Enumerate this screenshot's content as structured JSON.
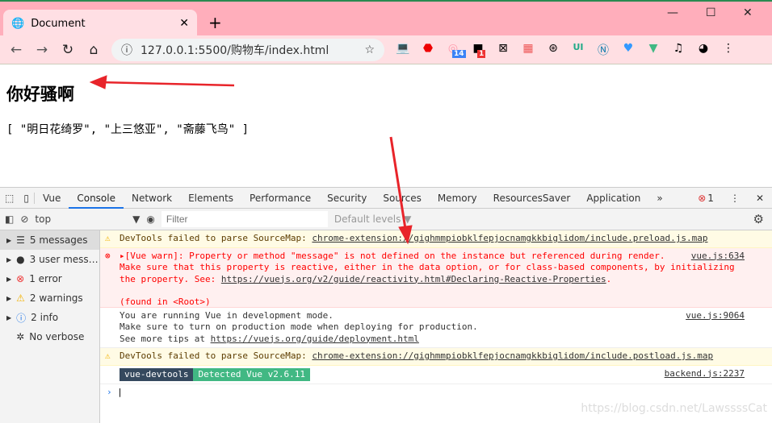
{
  "browser": {
    "tab_title": "Document",
    "url": "127.0.0.1:5500/购物车/index.html",
    "ext_badges": [
      "14",
      "1"
    ]
  },
  "page": {
    "heading": "你好骚啊",
    "array_text": "[ \"明日花绮罗\", \"上三悠亚\", \"斋藤飞鸟\" ]"
  },
  "devtools": {
    "tabs": [
      "Vue",
      "Console",
      "Network",
      "Elements",
      "Performance",
      "Security",
      "Sources",
      "Memory",
      "ResourcesSaver",
      "Application"
    ],
    "error_count": "1",
    "context": "top",
    "filter_placeholder": "Filter",
    "levels": "Default levels ▼",
    "sidebar": [
      {
        "label": "5 messages",
        "icon": "list"
      },
      {
        "label": "3 user mess…",
        "icon": "user"
      },
      {
        "label": "1 error",
        "icon": "error"
      },
      {
        "label": "2 warnings",
        "icon": "warning"
      },
      {
        "label": "2 info",
        "icon": "info"
      },
      {
        "label": "No verbose",
        "icon": "bug"
      }
    ],
    "messages": {
      "w1_text": "DevTools failed to parse SourceMap: ",
      "w1_link": "chrome-extension://gighmmpiobklfepjocnamgkkbiglidom/include.preload.js.map",
      "e_line1": "▸[Vue warn]: Property or method \"message\" is not defined on the instance but referenced during render.",
      "e_line2": "Make sure that this property is reactive, either in the data option, or for class-based components, by initializing",
      "e_line3": "the property. See: ",
      "e_link": "https://vuejs.org/v2/guide/reactivity.html#Declaring-Reactive-Properties",
      "e_dot": ".",
      "e_line4": "(found in <Root>)",
      "e_src": "vue.js:634",
      "i_line1": "You are running Vue in development mode.",
      "i_line2": "Make sure to turn on production mode when deploying for production.",
      "i_line3": "See more tips at ",
      "i_link": "https://vuejs.org/guide/deployment.html",
      "i_src": "vue.js:9064",
      "w2_text": "DevTools failed to parse SourceMap: ",
      "w2_link": "chrome-extension://gighmmpiobklfepjocnamgkkbiglidom/include.postload.js.map",
      "vd_badge1": "vue-devtools",
      "vd_badge2": "Detected Vue v2.6.11",
      "vd_src": "backend.js:2237"
    }
  },
  "watermark": "https://blog.csdn.net/LawssssCat",
  "colors": {
    "tabbar": "#ffaebb",
    "toolbar": "#ffdfe3",
    "accent": "#1a73e8",
    "vue_green": "#41b883",
    "annotation": "#e8242a"
  }
}
